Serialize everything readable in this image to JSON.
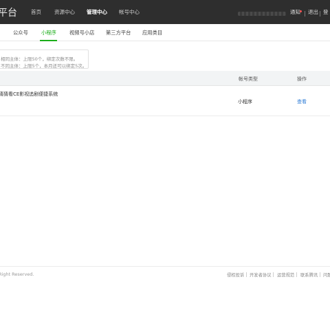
{
  "header": {
    "brand": "平台",
    "nav": [
      "首页",
      "资源中心",
      "管理中心",
      "帐号中心"
    ],
    "active_nav": "管理中心",
    "notice_label": "通知",
    "logout_label": "退出",
    "extra_label": "登"
  },
  "subtabs": {
    "items": [
      "公众号",
      "小程序",
      "视频号小店",
      "第三方平台",
      "应用类目"
    ],
    "active": "小程序"
  },
  "info": {
    "line1": "相同主体：上限50个，绑定次数不限。",
    "line2": "不同主体：上限5个，本月还可以绑定5次。"
  },
  "table": {
    "headers": {
      "name": "",
      "account_type": "帐号类型",
      "action": "操作"
    },
    "rows": [
      {
        "name": "猜猜看CE影视追剧便捷系统",
        "account_type": "小程序",
        "action": "查看"
      }
    ]
  },
  "footer": {
    "copyright": "Right Reserved.",
    "links": [
      "侵权投诉",
      "开发者协议",
      "运营规范",
      "联系腾讯",
      "问题"
    ]
  },
  "colors": {
    "topbar": "#2e2e2e",
    "accent_green": "#1aad19",
    "link_blue": "#2e7cd6"
  }
}
